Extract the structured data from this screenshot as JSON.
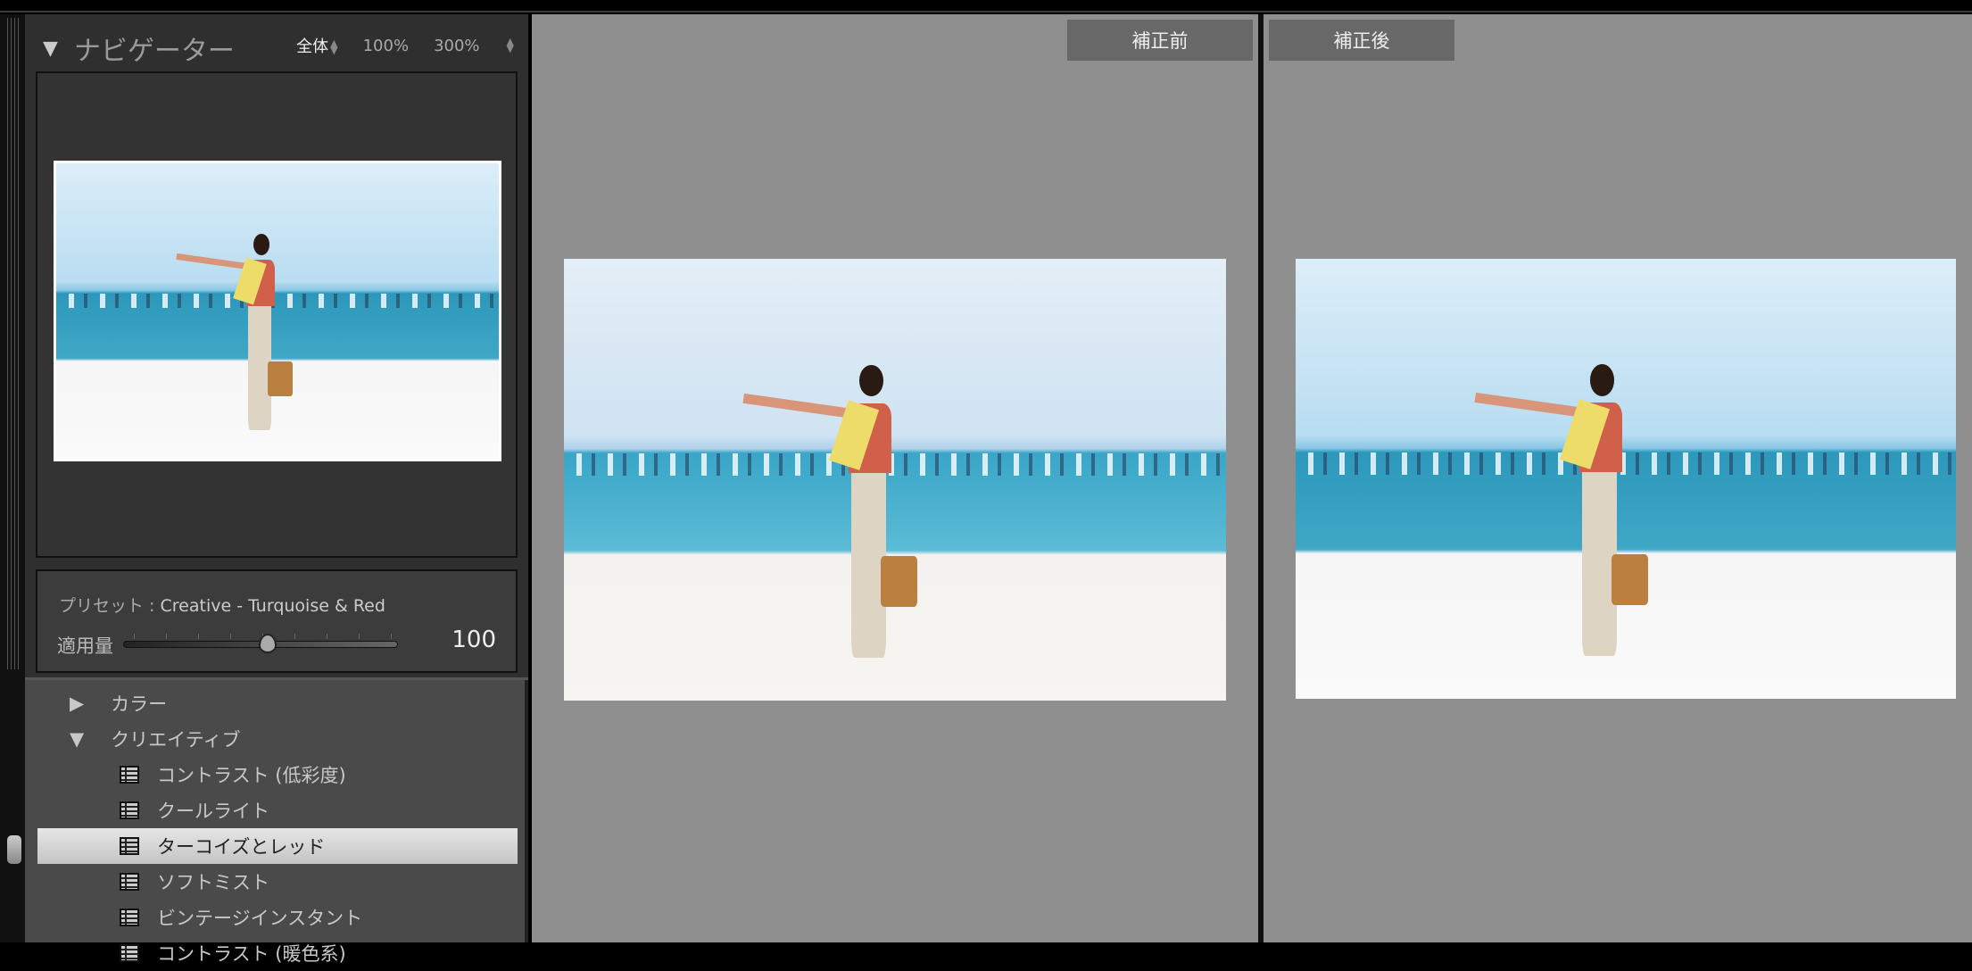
{
  "navigator": {
    "title": "ナビゲーター",
    "zoom_options": [
      "全体",
      "100%",
      "300%"
    ]
  },
  "preset_info": {
    "prefix": "プリセット :",
    "name": "Creative - Turquoise & Red",
    "amount_label": "適用量",
    "amount_value": "100",
    "amount_fraction": 0.5
  },
  "preset_list": {
    "groups": [
      {
        "label": "カラー",
        "expanded": false
      },
      {
        "label": "クリエイティブ",
        "expanded": true
      }
    ],
    "items": [
      {
        "label": "コントラスト (低彩度)",
        "selected": false
      },
      {
        "label": "クールライト",
        "selected": false
      },
      {
        "label": "ターコイズとレッド",
        "selected": true
      },
      {
        "label": "ソフトミスト",
        "selected": false
      },
      {
        "label": "ビンテージインスタント",
        "selected": false
      },
      {
        "label": "コントラスト (暖色系)",
        "selected": false
      }
    ]
  },
  "compare": {
    "before_label": "補正前",
    "after_label": "補正後"
  }
}
